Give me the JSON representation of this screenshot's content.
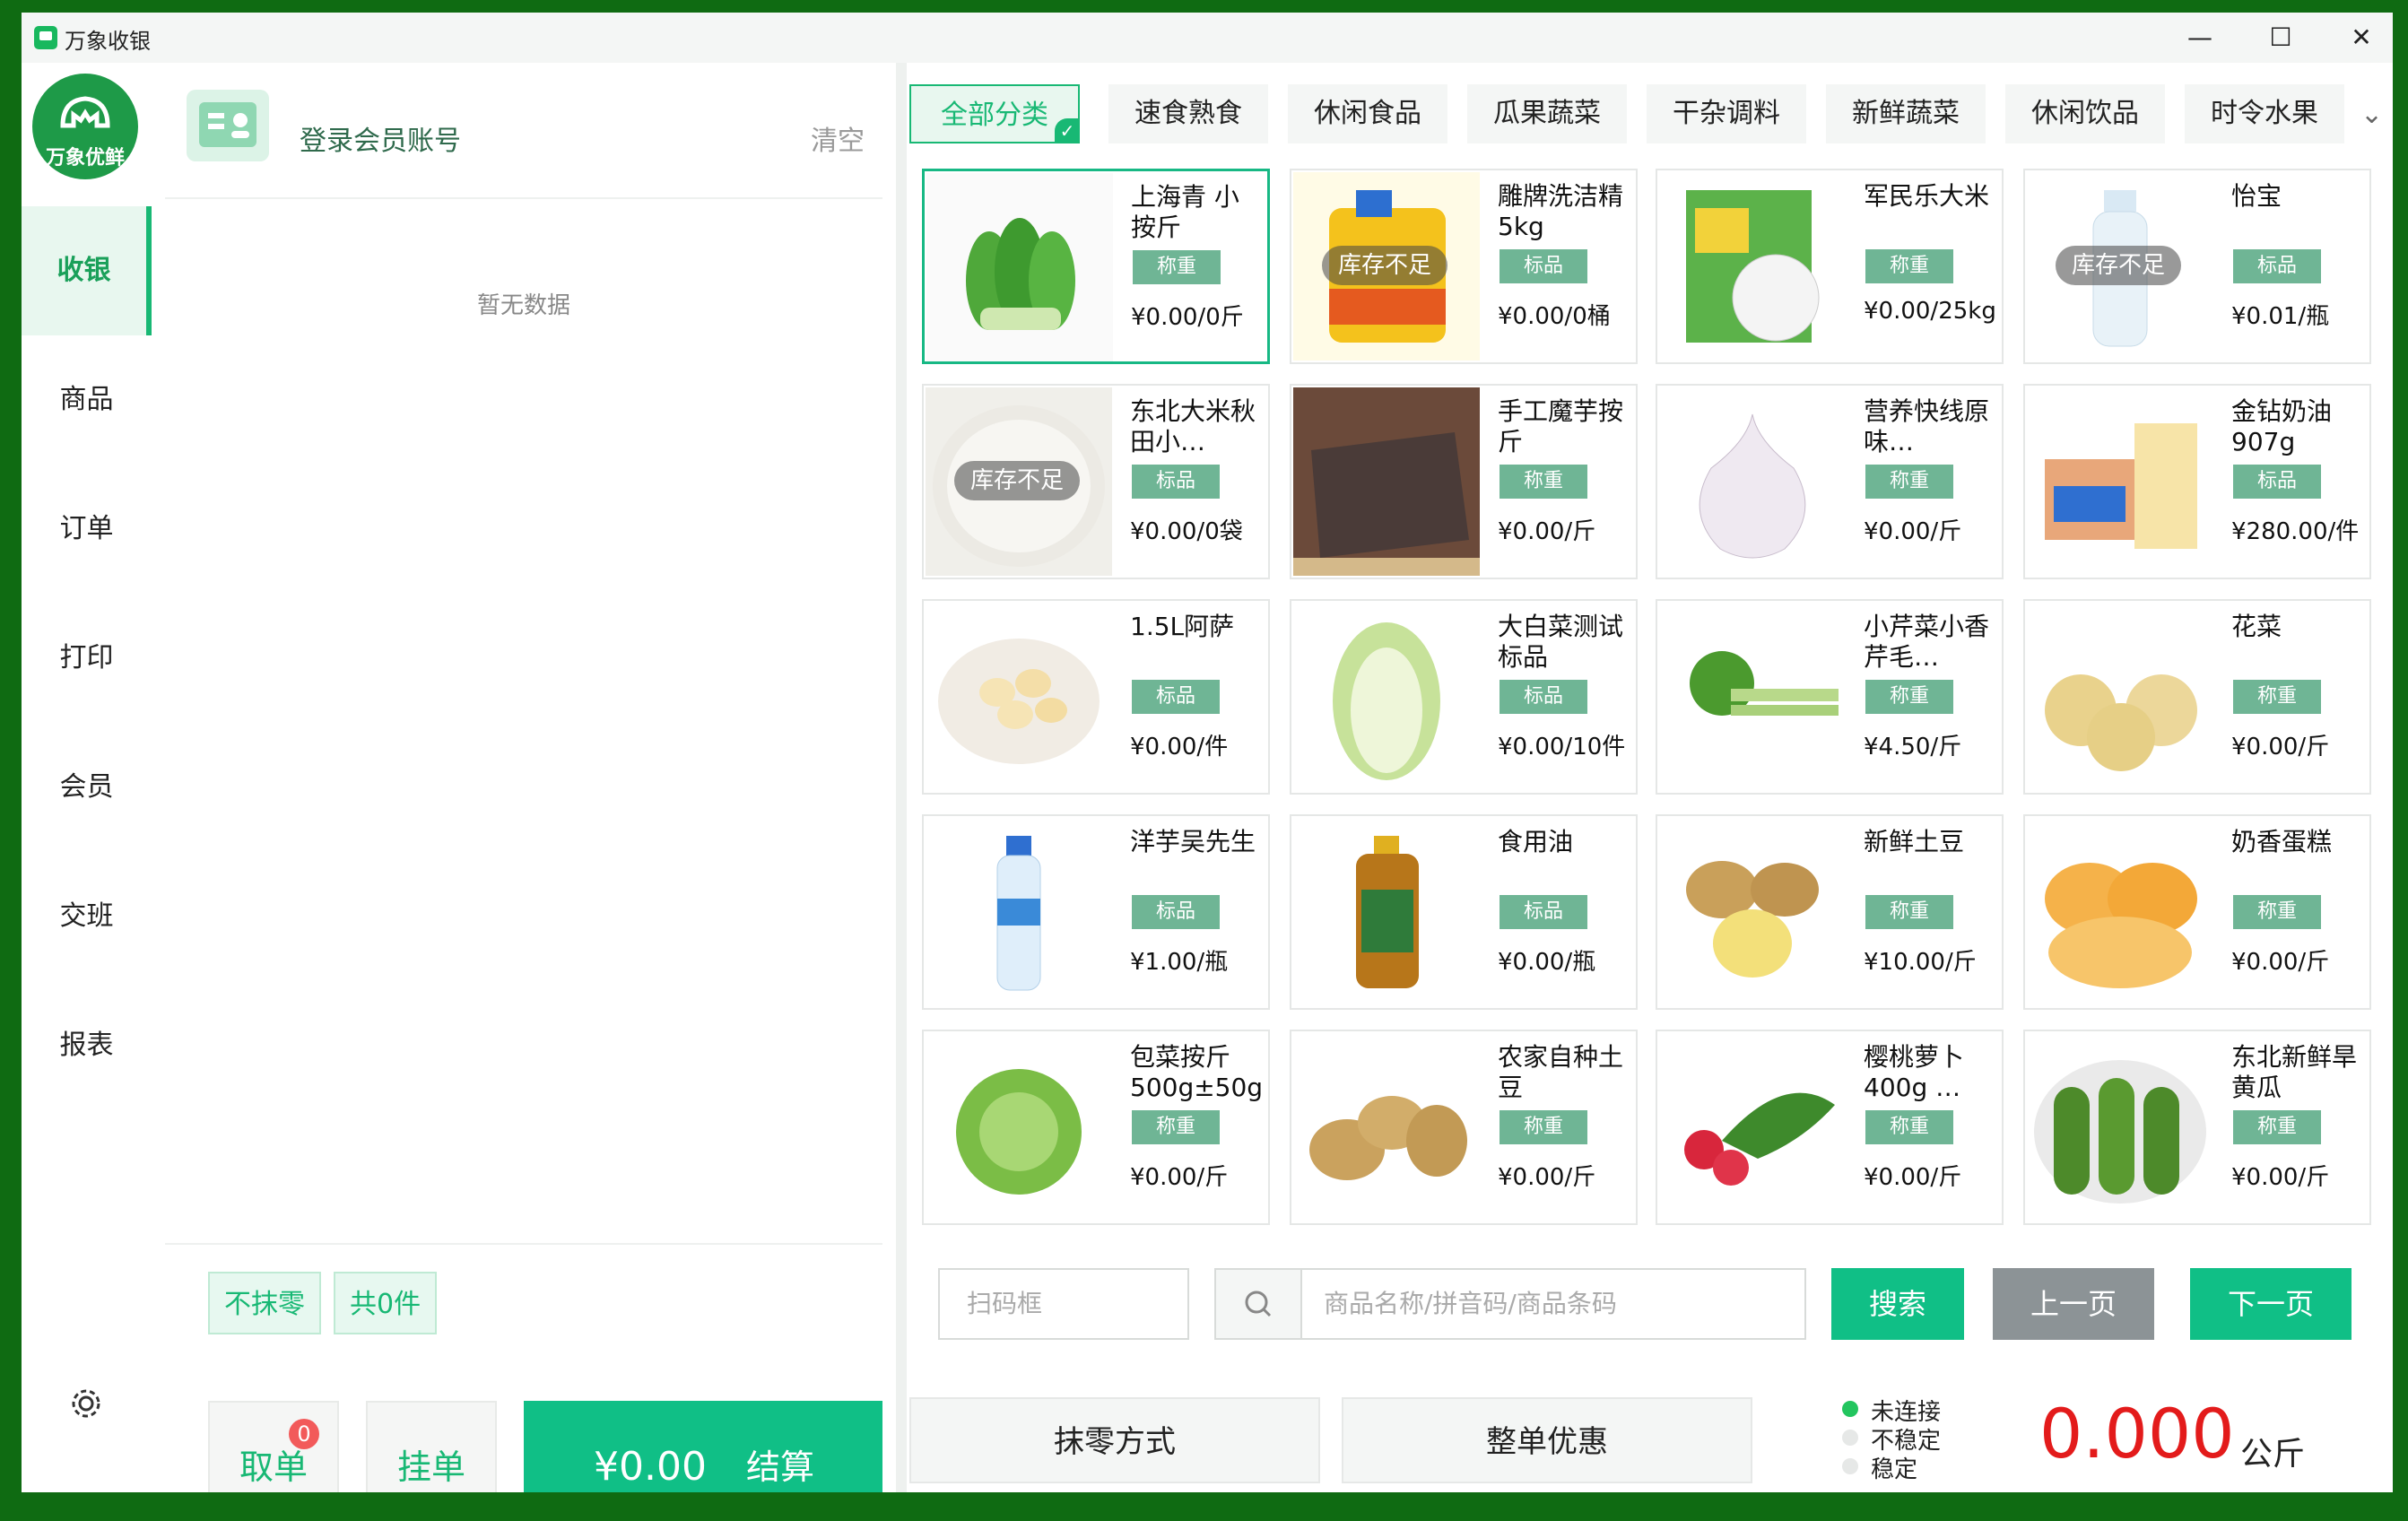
{
  "window": {
    "title": "万象收银",
    "minimize": "—",
    "maximize": "☐",
    "close": "✕"
  },
  "logo": {
    "text": "万象优鲜"
  },
  "nav": [
    {
      "label": "收银",
      "active": true
    },
    {
      "label": "商品"
    },
    {
      "label": "订单"
    },
    {
      "label": "打印"
    },
    {
      "label": "会员"
    },
    {
      "label": "交班"
    },
    {
      "label": "报表"
    }
  ],
  "member": {
    "login_label": "登录会员账号",
    "clear_label": "清空"
  },
  "cart": {
    "empty_text": "暂无数据",
    "no_round_label": "不抹零",
    "count_label": "共0件"
  },
  "actions": {
    "take_order": "取单",
    "take_order_badge": "0",
    "hold_order": "挂单",
    "total": "¥0.00",
    "checkout": "结算"
  },
  "categories": [
    "全部分类",
    "速食熟食",
    "休闲食品",
    "瓜果蔬菜",
    "干杂调料",
    "新鲜蔬菜",
    "休闲饮品",
    "时令水果"
  ],
  "out_of_stock": "库存不足",
  "products": [
    {
      "name": "上海青 小 按斤",
      "type": "称重",
      "price": "¥0.00/0斤",
      "img": "greens",
      "selected": true
    },
    {
      "name": "雕牌洗洁精5kg",
      "type": "标品",
      "price": "¥0.00/0桶",
      "img": "detergent",
      "oos": true
    },
    {
      "name": "军民乐大米",
      "type": "称重",
      "price": "¥0.00/25kg",
      "img": "ricebag"
    },
    {
      "name": "怡宝",
      "type": "标品",
      "price": "¥0.01/瓶",
      "img": "water",
      "oos": true
    },
    {
      "name": "东北大米秋田小…",
      "type": "标品",
      "price": "¥0.00/0袋",
      "img": "rice",
      "oos": true
    },
    {
      "name": "手工魔芋按斤",
      "type": "称重",
      "price": "¥0.00/斤",
      "img": "konjac"
    },
    {
      "name": "营养快线原味…",
      "type": "称重",
      "price": "¥0.00/斤",
      "img": "garlic"
    },
    {
      "name": "金钻奶油907g",
      "type": "标品",
      "price": "¥280.00/件",
      "img": "butter"
    },
    {
      "name": "1.5L阿萨",
      "type": "标品",
      "price": "¥0.00/件",
      "img": "cloves"
    },
    {
      "name": "大白菜测试标品",
      "type": "标品",
      "price": "¥0.00/10件",
      "img": "cabbage"
    },
    {
      "name": "小芹菜小香芹毛…",
      "type": "称重",
      "price": "¥4.50/斤",
      "img": "celery"
    },
    {
      "name": "花菜",
      "type": "称重",
      "price": "¥0.00/斤",
      "img": "pear"
    },
    {
      "name": "洋芋吴先生",
      "type": "标品",
      "price": "¥1.00/瓶",
      "img": "bottle"
    },
    {
      "name": "食用油",
      "type": "标品",
      "price": "¥0.00/瓶",
      "img": "oil"
    },
    {
      "name": "新鲜土豆",
      "type": "称重",
      "price": "¥10.00/斤",
      "img": "potato"
    },
    {
      "name": "奶香蛋糕",
      "type": "称重",
      "price": "¥0.00/斤",
      "img": "cake"
    },
    {
      "name": "包菜按斤500g±50g",
      "type": "称重",
      "price": "¥0.00/斤",
      "img": "greencabbage"
    },
    {
      "name": "农家自种土豆",
      "type": "称重",
      "price": "¥0.00/斤",
      "img": "potato2"
    },
    {
      "name": "樱桃萝卜400g …",
      "type": "称重",
      "price": "¥0.00/斤",
      "img": "radish"
    },
    {
      "name": "东北新鲜旱黄瓜",
      "type": "称重",
      "price": "¥0.00/斤",
      "img": "cucumber"
    }
  ],
  "search": {
    "scan_placeholder": "扫码框",
    "search_placeholder": "商品名称/拼音码/商品条码",
    "search_btn": "搜索",
    "prev": "上一页",
    "next": "下一页"
  },
  "bottom": {
    "rounding": "抹零方式",
    "discount": "整单优惠"
  },
  "scale": {
    "status": [
      "未连接",
      "不稳定",
      "稳定"
    ],
    "weight": "0.000",
    "unit": "公斤"
  },
  "colors": {
    "accent": "#10bf86",
    "connected_dot": "#22c55e",
    "weight": "#e31b1b"
  }
}
